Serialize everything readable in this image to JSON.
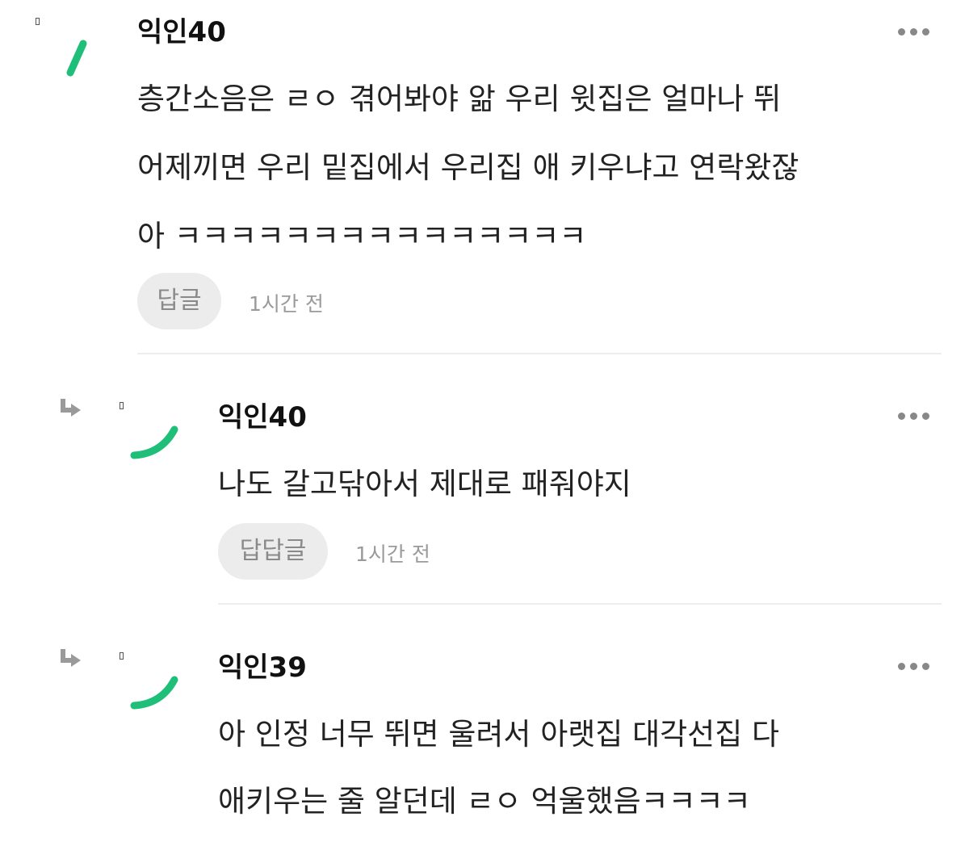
{
  "comments": [
    {
      "author": "익인40",
      "lines": [
        "층간소음은 ㄹㅇ 겪어봐야 앎 우리 윗집은 얼마나 뛰",
        "어제끼면 우리 밑집에서 우리집 애 키우냐고 연락왔잖",
        "아 ㅋㅋㅋㅋㅋㅋㅋㅋㅋㅋㅋㅋㅋㅋㅋ"
      ],
      "reply_label": "답글",
      "time": "1시간 전",
      "more_icon": "more-dots-icon"
    },
    {
      "author": "익인40",
      "lines": [
        "나도 갈고닦아서 제대로 패줘야지"
      ],
      "reply_label": "답답글",
      "time": "1시간 전",
      "more_icon": "more-dots-icon",
      "reply_icon": "reply-arrow-icon"
    },
    {
      "author": "익인39",
      "lines": [
        "아 인정 너무 뛰면 울려서 아랫집 대각선집 다",
        "애키우는 줄 알던데 ㄹㅇ 억울했음ㅋㅋㅋㅋ"
      ],
      "more_icon": "more-dots-icon",
      "reply_icon": "reply-arrow-icon"
    }
  ],
  "colors": {
    "avatar_green": "#1fbf7a",
    "button_bg": "#ececec",
    "muted_text": "#9a9a9a",
    "divider": "#eeeeee"
  }
}
